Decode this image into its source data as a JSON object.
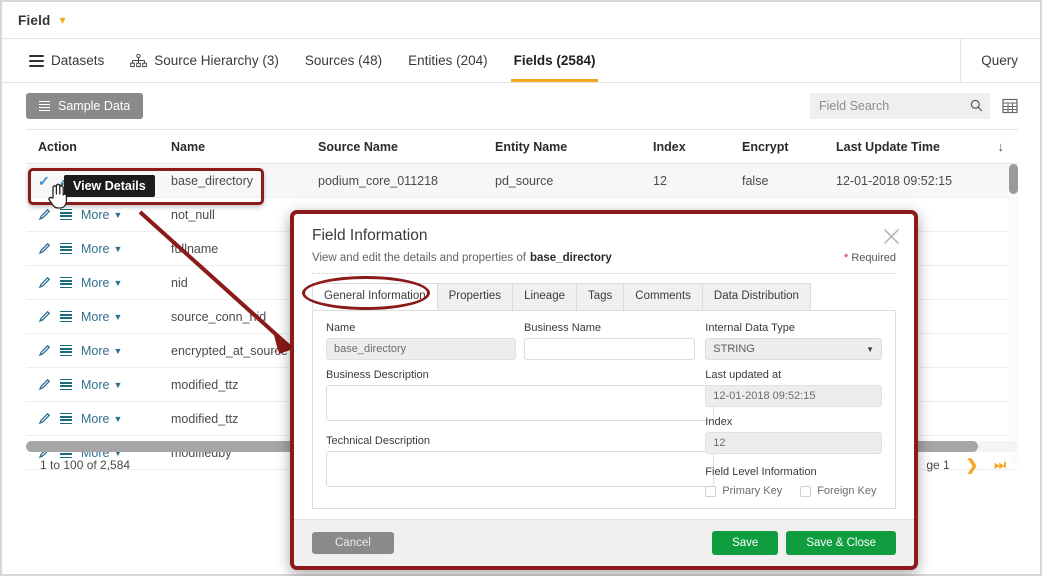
{
  "topbar": {
    "title": "Field",
    "caret_icon": "chevron-down-icon"
  },
  "nav": {
    "items": [
      {
        "label": "Datasets",
        "icon": "hamburger-icon",
        "active": false
      },
      {
        "label": "Source Hierarchy (3)",
        "icon": "hierarchy-icon",
        "active": false
      },
      {
        "label": "Sources (48)",
        "icon": "",
        "active": false
      },
      {
        "label": "Entities (204)",
        "icon": "",
        "active": false
      },
      {
        "label": "Fields (2584)",
        "icon": "",
        "active": true
      }
    ],
    "right_label": "Query"
  },
  "toolbar": {
    "sample_data_label": "Sample Data",
    "sample_data_icon": "stack-icon",
    "search_placeholder": "Field Search",
    "search_value": "",
    "search_icon": "search-icon",
    "grid_icon": "grid-view-icon"
  },
  "table": {
    "columns": [
      "Action",
      "Name",
      "Source Name",
      "Entity Name",
      "Index",
      "Encrypt",
      "Last Update Time"
    ],
    "sort_icon": "arrow-down-icon",
    "rows": [
      {
        "action": "selected",
        "name": "base_directory",
        "source": "podium_core_011218",
        "entity": "pd_source",
        "index": "12",
        "encrypt": "false",
        "updated": "12-01-2018 09:52:15"
      },
      {
        "action": "more",
        "more_label": "More",
        "name": "not_null",
        "source": "",
        "entity": "",
        "index": "",
        "encrypt": "",
        "updated": ""
      },
      {
        "action": "more",
        "more_label": "More",
        "name": "fullname",
        "source": "",
        "entity": "",
        "index": "",
        "encrypt": "",
        "updated": ""
      },
      {
        "action": "more",
        "more_label": "More",
        "name": "nid",
        "source": "",
        "entity": "",
        "index": "",
        "encrypt": "",
        "updated": ""
      },
      {
        "action": "more",
        "more_label": "More",
        "name": "source_conn_nid",
        "source": "",
        "entity": "",
        "index": "",
        "encrypt": "",
        "updated": ""
      },
      {
        "action": "more",
        "more_label": "More",
        "name": "encrypted_at_source",
        "source": "",
        "entity": "",
        "index": "",
        "encrypt": "",
        "updated": ""
      },
      {
        "action": "more",
        "more_label": "More",
        "name": "modified_ttz",
        "source": "",
        "entity": "",
        "index": "",
        "encrypt": "",
        "updated": ""
      },
      {
        "action": "more",
        "more_label": "More",
        "name": "modified_ttz",
        "source": "",
        "entity": "",
        "index": "",
        "encrypt": "",
        "updated": ""
      },
      {
        "action": "more",
        "more_label": "More",
        "name": "modifiedby",
        "source": "",
        "entity": "",
        "index": "",
        "encrypt": "",
        "updated": ""
      }
    ],
    "footer_count": "1 to 100 of 2,584",
    "page_label": "ge 1",
    "next_arrow": "❯",
    "last_arrow": "⏭"
  },
  "tooltip": {
    "label": "View Details"
  },
  "modal": {
    "title": "Field Information",
    "subtitle_prefix": "View and edit the details and properties of",
    "subtitle_field": "base_directory",
    "required_star": "*",
    "required_label": "Required",
    "close_icon": "close-icon",
    "tabs": [
      {
        "label": "General Information",
        "active": true
      },
      {
        "label": "Properties",
        "active": false
      },
      {
        "label": "Lineage",
        "active": false
      },
      {
        "label": "Tags",
        "active": false
      },
      {
        "label": "Comments",
        "active": false
      },
      {
        "label": "Data Distribution",
        "active": false
      }
    ],
    "form": {
      "name_label": "Name",
      "name_value": "base_directory",
      "business_name_label": "Business Name",
      "business_name_value": "",
      "internal_data_type_label": "Internal Data Type",
      "internal_data_type_value": "STRING",
      "business_description_label": "Business Description",
      "business_description_value": "",
      "last_updated_label": "Last updated at",
      "last_updated_value": "12-01-2018 09:52:15",
      "technical_description_label": "Technical Description",
      "technical_description_value": "",
      "index_label": "Index",
      "index_value": "12",
      "field_level_info_label": "Field Level Information",
      "primary_key_label": "Primary Key",
      "foreign_key_label": "Foreign Key"
    },
    "footer": {
      "cancel_label": "Cancel",
      "save_label": "Save",
      "save_close_label": "Save & Close"
    }
  },
  "colors": {
    "accent_orange": "#f5a623",
    "annotation_red": "#8b1a1a",
    "save_green": "#0f9d3f",
    "link_blue": "#2f6f8f"
  }
}
